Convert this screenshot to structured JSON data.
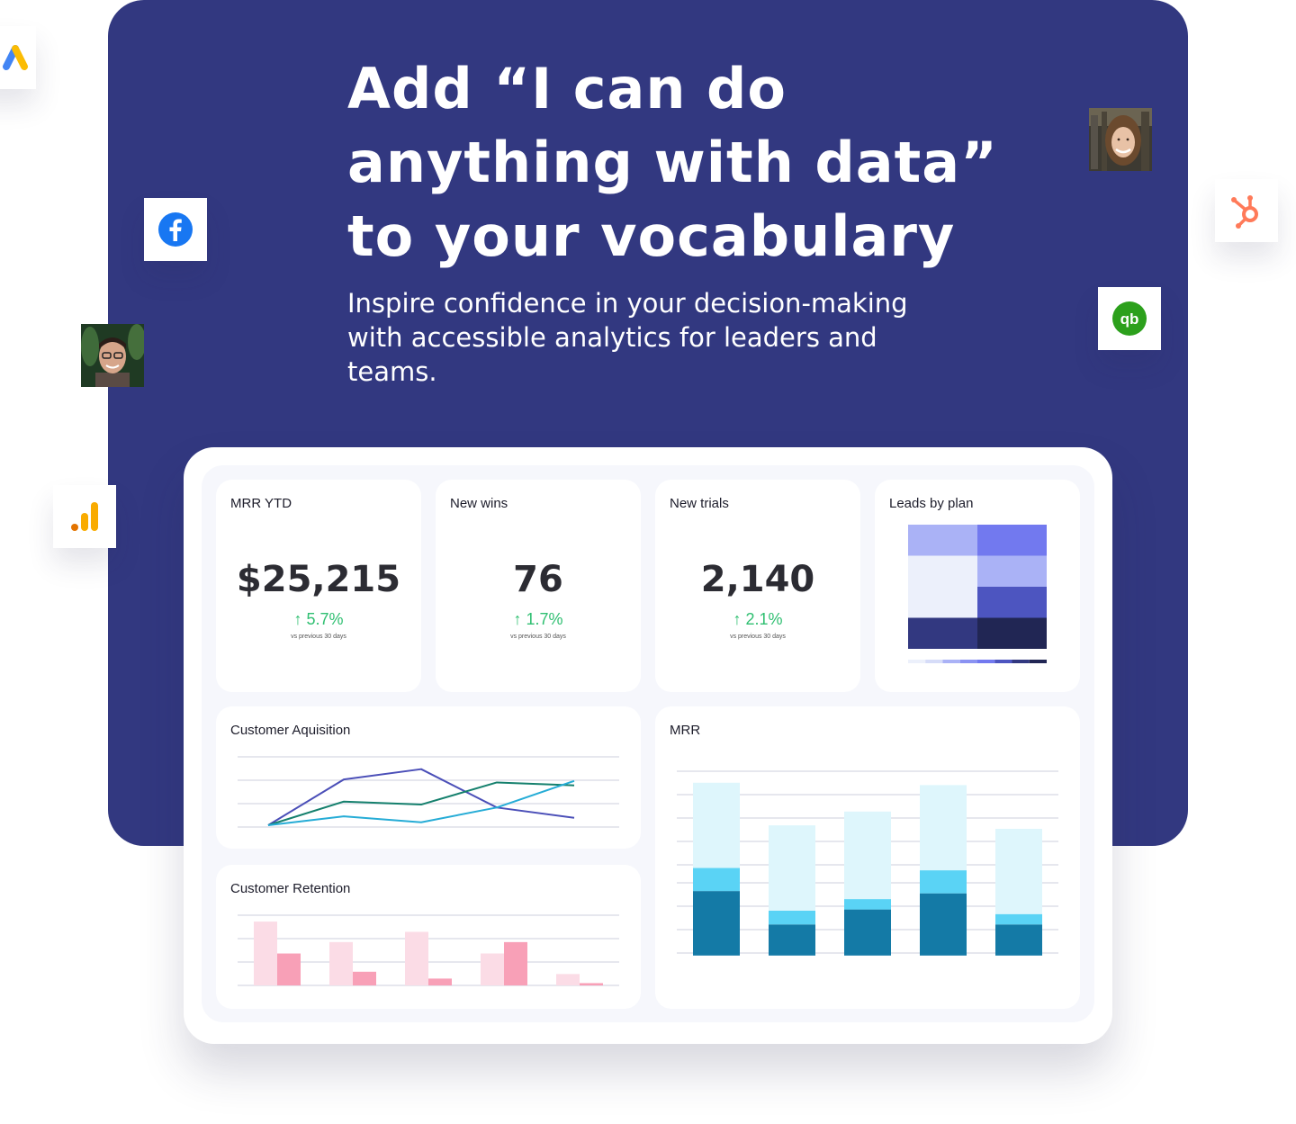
{
  "hero": {
    "headline_lines": [
      "Add “I can do",
      "anything with data”",
      "to your vocabulary"
    ],
    "subtitle_lines": [
      "Inspire confidence in your decision-making",
      "with accessible analytics for leaders and",
      "teams."
    ]
  },
  "integrations": [
    {
      "name": "google-ads-icon"
    },
    {
      "name": "facebook-icon"
    },
    {
      "name": "google-analytics-icon"
    },
    {
      "name": "hubspot-icon"
    },
    {
      "name": "quickbooks-icon",
      "text": "qb"
    }
  ],
  "dashboard": {
    "kpis": [
      {
        "title": "MRR YTD",
        "value": "$25,215",
        "delta": "↑ 5.7%",
        "note": "vs previous 30 days"
      },
      {
        "title": "New wins",
        "value": "76",
        "delta": "↑ 1.7%",
        "note": "vs previous 30 days"
      },
      {
        "title": "New trials",
        "value": "2,140",
        "delta": "↑ 2.1%",
        "note": "vs previous 30 days"
      }
    ],
    "leads_title": "Leads by plan",
    "acq_title": "Customer Aquisition",
    "ret_title": "Customer Retention",
    "mrr_title": "MRR"
  },
  "chart_data": [
    {
      "type": "heatmap",
      "title": "Leads by plan",
      "rows": 4,
      "cols": 2,
      "values": [
        [
          2,
          4
        ],
        [
          0,
          2
        ],
        [
          0,
          5
        ],
        [
          6,
          7
        ]
      ],
      "colors": [
        "#ecf0fb",
        "#d6dcf8",
        "#aab2f6",
        "#8a92f2",
        "#7279ef",
        "#4d55c0",
        "#323880",
        "#212654"
      ]
    },
    {
      "type": "line",
      "title": "Customer Aquisition",
      "ylim": [
        0,
        5
      ],
      "series": [
        {
          "values": [
            0,
            3.1,
            3.8,
            1.2,
            0.5
          ],
          "color": "#4b4fb8"
        },
        {
          "values": [
            0,
            1.6,
            1.4,
            2.9,
            2.7
          ],
          "color": "#15806d"
        },
        {
          "values": [
            0,
            0.6,
            0.2,
            1.2,
            3.0
          ],
          "color": "#26acd6"
        }
      ]
    },
    {
      "type": "bar",
      "title": "Customer Retention",
      "ylim": [
        0,
        3
      ],
      "series": [
        {
          "values": [
            2.8,
            1.9,
            2.35,
            1.4,
            0.5
          ],
          "color": "#fbdce6"
        },
        {
          "values": [
            1.4,
            0.6,
            0.3,
            1.9,
            0.1
          ],
          "color": "#f8a0b7"
        }
      ]
    },
    {
      "type": "bar",
      "title": "MRR",
      "stacked": true,
      "ylim": [
        0,
        8
      ],
      "series": [
        {
          "values": [
            2.8,
            1.35,
            2.0,
            2.7,
            1.35
          ],
          "color": "#147aa6"
        },
        {
          "values": [
            1.0,
            0.6,
            0.45,
            1.0,
            0.45
          ],
          "color": "#5ad3f5"
        },
        {
          "values": [
            3.7,
            3.7,
            3.8,
            3.7,
            3.7
          ],
          "color": "#def6fc"
        }
      ]
    }
  ]
}
